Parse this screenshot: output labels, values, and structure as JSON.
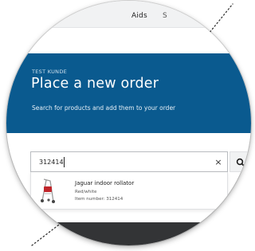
{
  "nav": {
    "aids_label": "Aids",
    "next_label": "S"
  },
  "hero": {
    "eyebrow": "TEST KUNDE",
    "title": "Place a new order",
    "subtitle": "Search for products and add them to your order"
  },
  "search": {
    "value": "312414",
    "clear_label": "×"
  },
  "results": [
    {
      "name": "Jaguar indoor rollator",
      "color": "Red/white",
      "item_number": "Item number: 312414"
    }
  ],
  "colors": {
    "brand_blue": "#0a5a8f",
    "nav_bg": "#f1f2f3",
    "footer_dark": "#333436"
  }
}
